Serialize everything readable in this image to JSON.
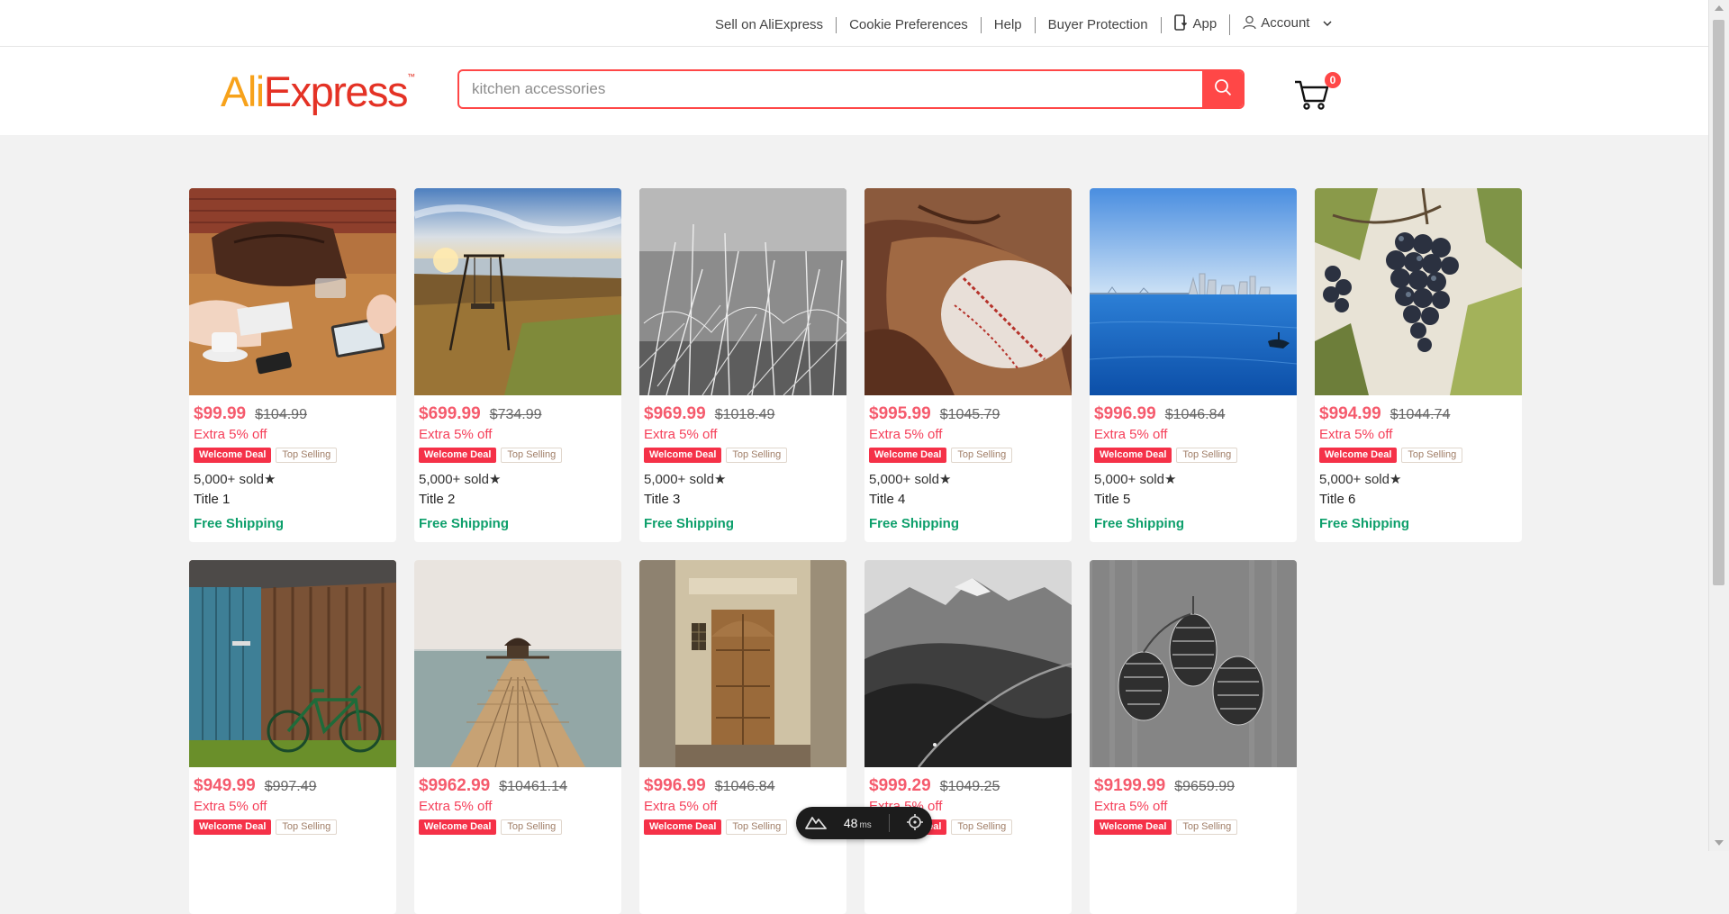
{
  "topbar": {
    "links": [
      "Sell on AliExpress",
      "Cookie Preferences",
      "Help",
      "Buyer Protection"
    ],
    "app_label": "App",
    "account_label": "Account"
  },
  "header": {
    "logo_ali": "Ali",
    "logo_express": "Express",
    "logo_tm": "™",
    "search_placeholder": "kitchen accessories",
    "cart_count": "0"
  },
  "colors": {
    "accent": "#ff4747",
    "price": "#f55b6d",
    "shipping": "#0d9f6b",
    "logo_orange": "#f7a21b",
    "logo_red": "#e43225"
  },
  "products": [
    {
      "price": "$99.99",
      "old_price": "$104.99",
      "extra": "Extra 5% off",
      "badge1": "Welcome Deal",
      "badge2": "Top Selling",
      "sold": "5,000+ sold★",
      "title": "Title 1",
      "shipping": "Free Shipping"
    },
    {
      "price": "$699.99",
      "old_price": "$734.99",
      "extra": "Extra 5% off",
      "badge1": "Welcome Deal",
      "badge2": "Top Selling",
      "sold": "5,000+ sold★",
      "title": "Title 2",
      "shipping": "Free Shipping"
    },
    {
      "price": "$969.99",
      "old_price": "$1018.49",
      "extra": "Extra 5% off",
      "badge1": "Welcome Deal",
      "badge2": "Top Selling",
      "sold": "5,000+ sold★",
      "title": "Title 3",
      "shipping": "Free Shipping"
    },
    {
      "price": "$995.99",
      "old_price": "$1045.79",
      "extra": "Extra 5% off",
      "badge1": "Welcome Deal",
      "badge2": "Top Selling",
      "sold": "5,000+ sold★",
      "title": "Title 4",
      "shipping": "Free Shipping"
    },
    {
      "price": "$996.99",
      "old_price": "$1046.84",
      "extra": "Extra 5% off",
      "badge1": "Welcome Deal",
      "badge2": "Top Selling",
      "sold": "5,000+ sold★",
      "title": "Title 5",
      "shipping": "Free Shipping"
    },
    {
      "price": "$994.99",
      "old_price": "$1044.74",
      "extra": "Extra 5% off",
      "badge1": "Welcome Deal",
      "badge2": "Top Selling",
      "sold": "5,000+ sold★",
      "title": "Title 6",
      "shipping": "Free Shipping"
    },
    {
      "price": "$949.99",
      "old_price": "$997.49",
      "extra": "Extra 5% off",
      "badge1": "Welcome Deal",
      "badge2": "Top Selling",
      "sold": "",
      "title": "",
      "shipping": ""
    },
    {
      "price": "$9962.99",
      "old_price": "$10461.14",
      "extra": "Extra 5% off",
      "badge1": "Welcome Deal",
      "badge2": "Top Selling",
      "sold": "",
      "title": "",
      "shipping": ""
    },
    {
      "price": "$996.99",
      "old_price": "$1046.84",
      "extra": "Extra 5% off",
      "badge1": "Welcome Deal",
      "badge2": "Top Selling",
      "sold": "",
      "title": "",
      "shipping": ""
    },
    {
      "price": "$999.29",
      "old_price": "$1049.25",
      "extra": "Extra 5% off",
      "badge1": "Welcome Deal",
      "badge2": "Top Selling",
      "sold": "",
      "title": "",
      "shipping": ""
    },
    {
      "price": "$9199.99",
      "old_price": "$9659.99",
      "extra": "Extra 5% off",
      "badge1": "Welcome Deal",
      "badge2": "Top Selling",
      "sold": "",
      "title": "",
      "shipping": ""
    }
  ],
  "devbar": {
    "timing": "48",
    "unit": "ms"
  }
}
